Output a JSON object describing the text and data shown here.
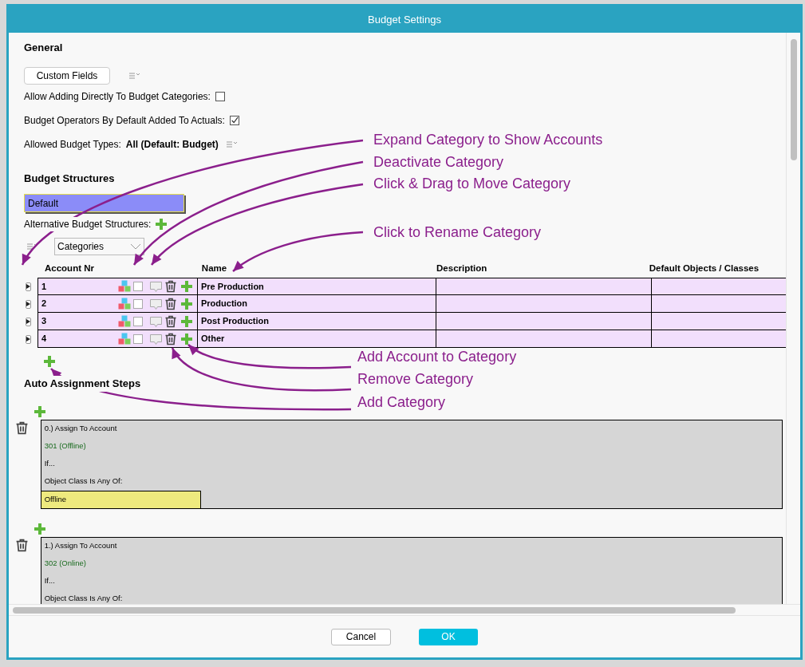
{
  "window": {
    "title": "Budget Settings"
  },
  "general": {
    "heading": "General",
    "custom_fields_button": "Custom Fields",
    "settings": [
      {
        "label": "Allow Adding Directly To Budget Categories:",
        "kind": "checkbox",
        "checked": false
      },
      {
        "label": "Budget Operators By Default Added To Actuals:",
        "kind": "checkbox",
        "checked": true
      },
      {
        "label": "Allowed Budget Types:",
        "kind": "value",
        "value": "All (Default: Budget)"
      }
    ]
  },
  "budget_structures": {
    "heading": "Budget Structures",
    "selected_structure": "Default",
    "alternative_label": "Alternative Budget Structures:",
    "view_dropdown": "Categories"
  },
  "table": {
    "columns": [
      "Account Nr",
      "Name",
      "Description",
      "Default Objects / Classes"
    ],
    "rows": [
      {
        "account_nr": "1",
        "name": "Pre Production",
        "deactivated": false
      },
      {
        "account_nr": "2",
        "name": "Production",
        "deactivated": false
      },
      {
        "account_nr": "3",
        "name": "Post Production",
        "deactivated": false
      },
      {
        "account_nr": "4",
        "name": "Other",
        "deactivated": false
      }
    ]
  },
  "auto_assignment": {
    "heading": "Auto Assignment Steps",
    "steps": [
      {
        "title": "0.) Assign To Account",
        "account": "301 (Offline)",
        "condition": "If...",
        "rule": "Object Class Is Any Of:",
        "classes": [
          "Offline"
        ]
      },
      {
        "title": "1.) Assign To Account",
        "account": "302 (Online)",
        "condition": "If...",
        "rule": "Object Class Is Any Of:"
      }
    ]
  },
  "annotations": [
    {
      "text": "Expand Category to Show Accounts"
    },
    {
      "text": "Deactivate Category"
    },
    {
      "text": "Click & Drag to Move Category"
    },
    {
      "text": "Click to Rename Category"
    },
    {
      "text": "Add Account to Category"
    },
    {
      "text": "Remove Category"
    },
    {
      "text": "Add Category"
    }
  ],
  "footer": {
    "buttons": [
      {
        "label": "Cancel",
        "kind": "secondary"
      },
      {
        "label": "OK",
        "kind": "primary"
      }
    ]
  }
}
